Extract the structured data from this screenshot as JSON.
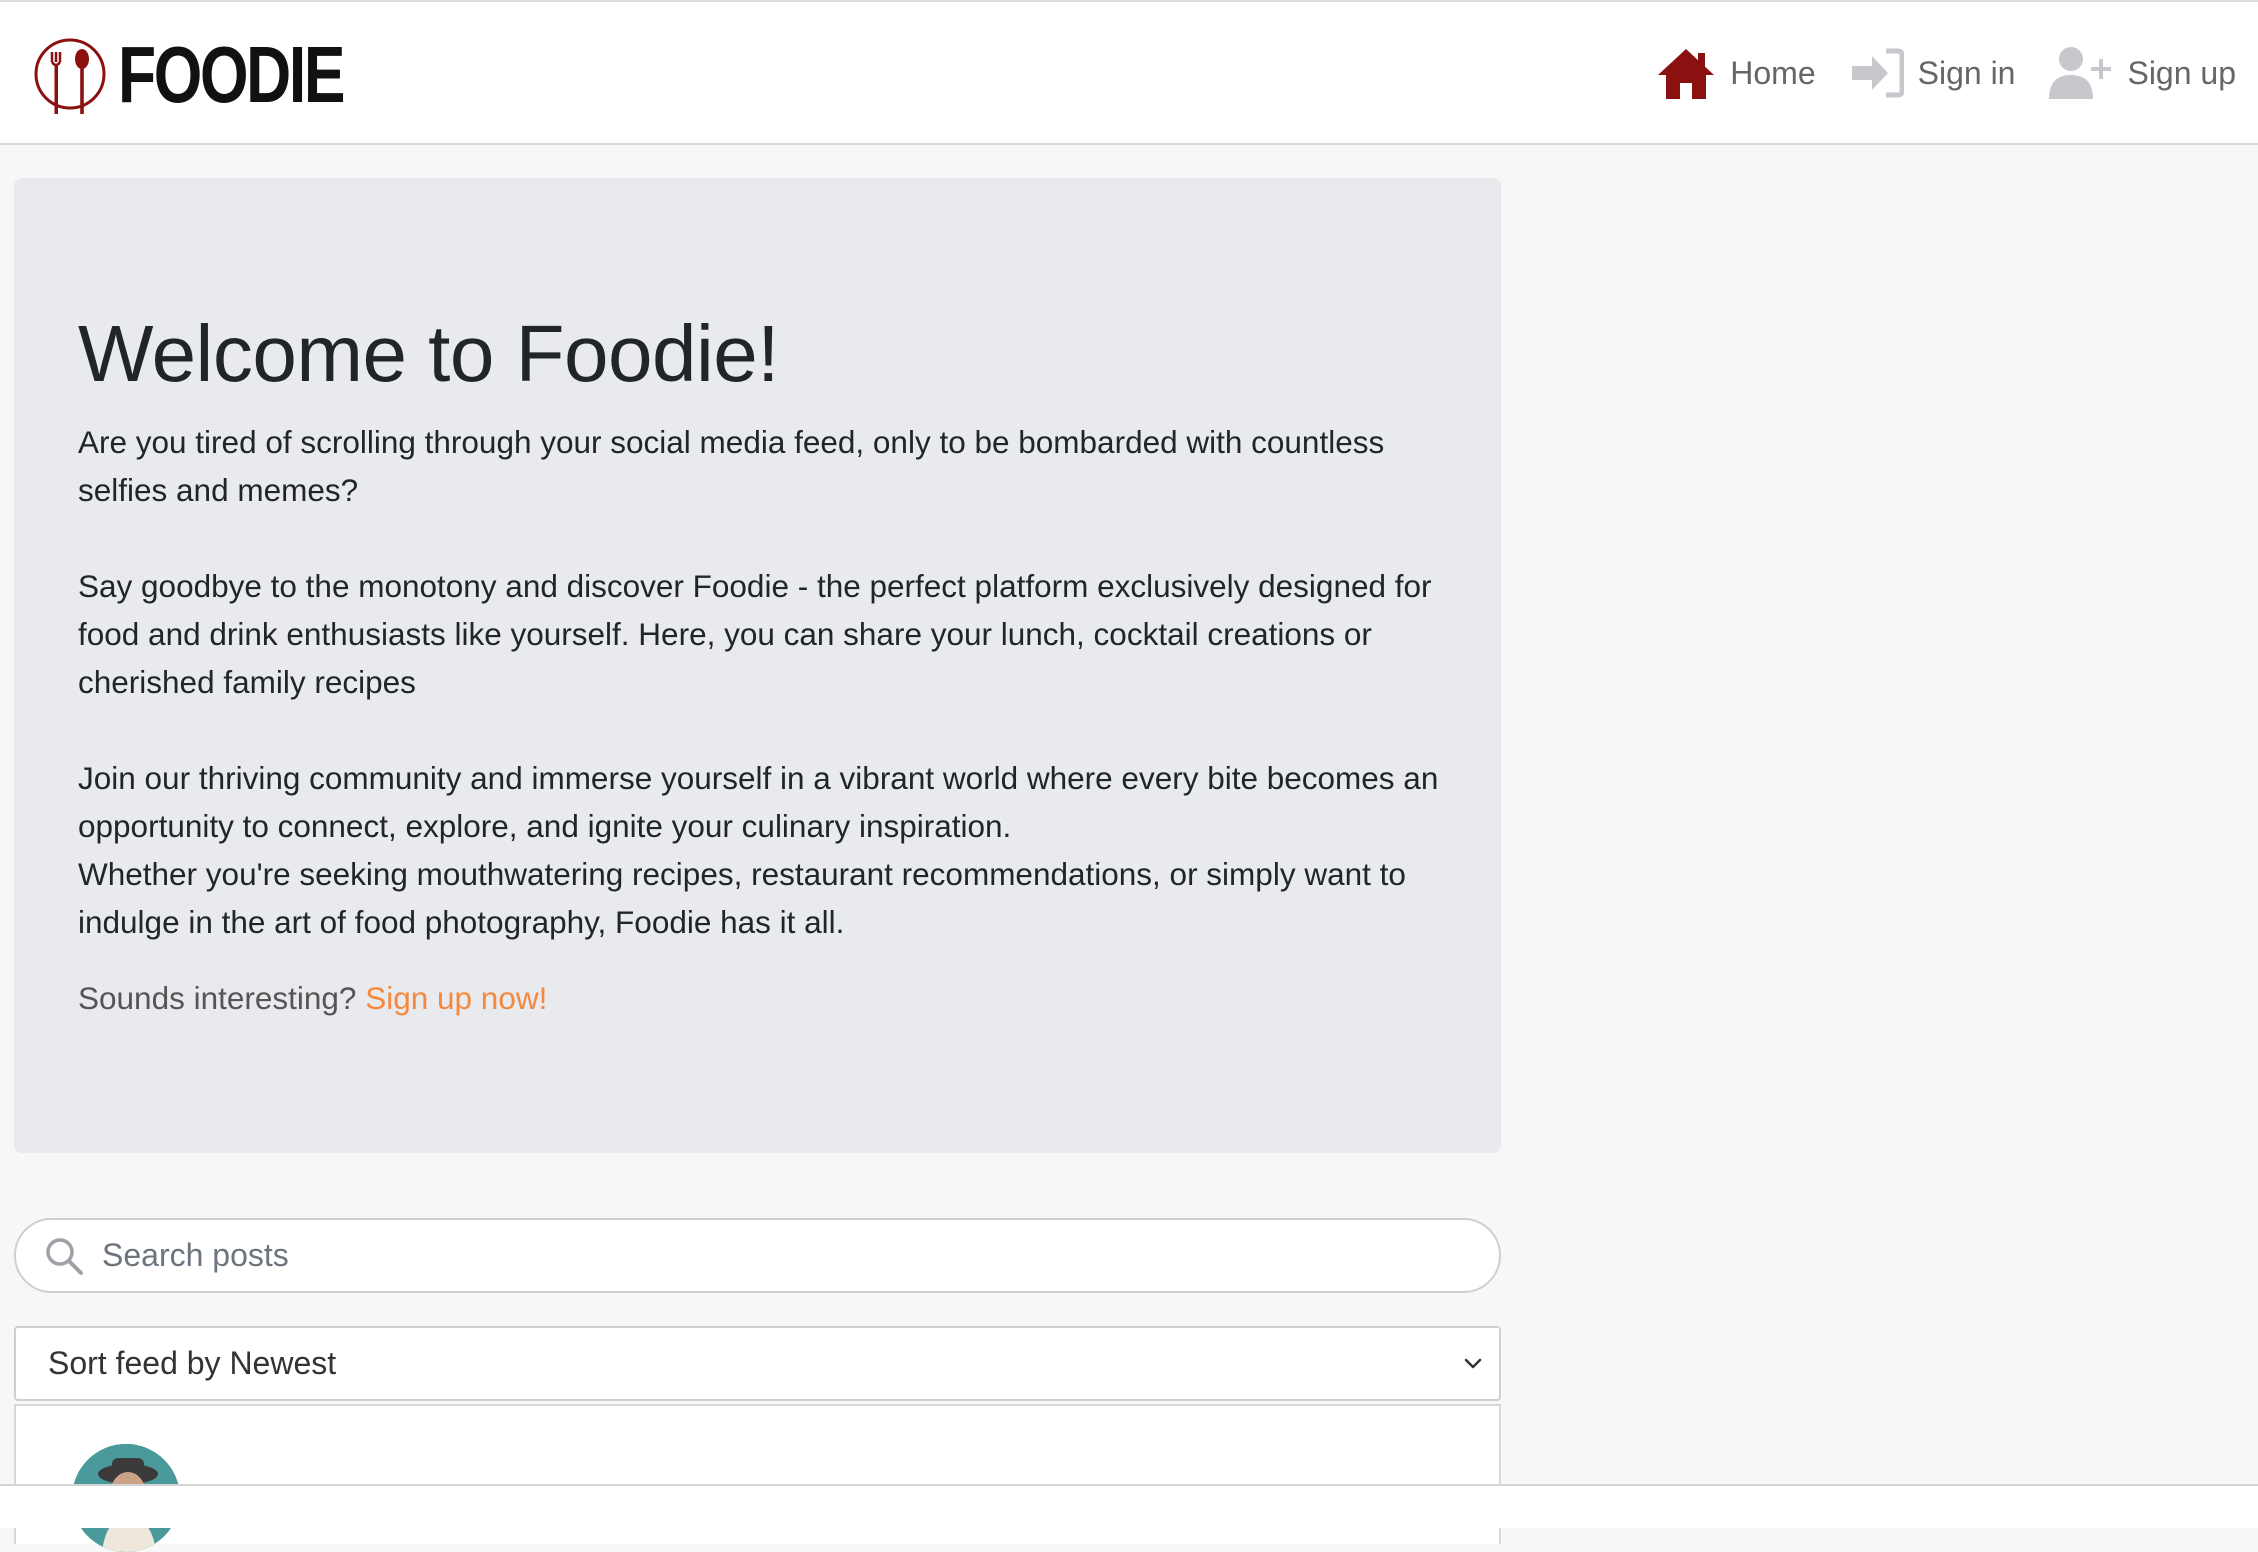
{
  "brand": {
    "name": "FOODIE",
    "accent_color": "#8b1111"
  },
  "nav": {
    "home": {
      "label": "Home",
      "icon": "home-icon"
    },
    "sign_in": {
      "label": "Sign in",
      "icon": "sign-in-icon"
    },
    "sign_up": {
      "label": "Sign up",
      "icon": "user-plus-icon"
    }
  },
  "hero": {
    "title": "Welcome to Foodie!",
    "paragraph_1": "Are you tired of scrolling through your social media feed, only to be bombarded with countless selfies and memes?",
    "paragraph_2": "Say goodbye to the monotony and discover Foodie - the perfect platform exclusively designed for food and drink enthusiasts like yourself. Here, you can share your lunch, cocktail creations or cherished family recipes",
    "paragraph_3a": "Join our thriving community and immerse yourself in a vibrant world where every bite becomes an opportunity to connect, explore, and ignite your culinary inspiration.",
    "paragraph_3b": "Whether you're seeking mouthwatering recipes, restaurant recommendations, or simply want to indulge in the art of food photography, Foodie has it all.",
    "cta_prefix": "Sounds interesting?",
    "cta_link": "Sign up now!",
    "cta_color": "#f5883d"
  },
  "search": {
    "placeholder": "Search posts",
    "icon": "search-icon"
  },
  "sort": {
    "selected": "Sort feed by Newest",
    "icon": "chevron-down-icon"
  },
  "feed": {
    "first_post": {
      "avatar": "user-avatar"
    }
  }
}
